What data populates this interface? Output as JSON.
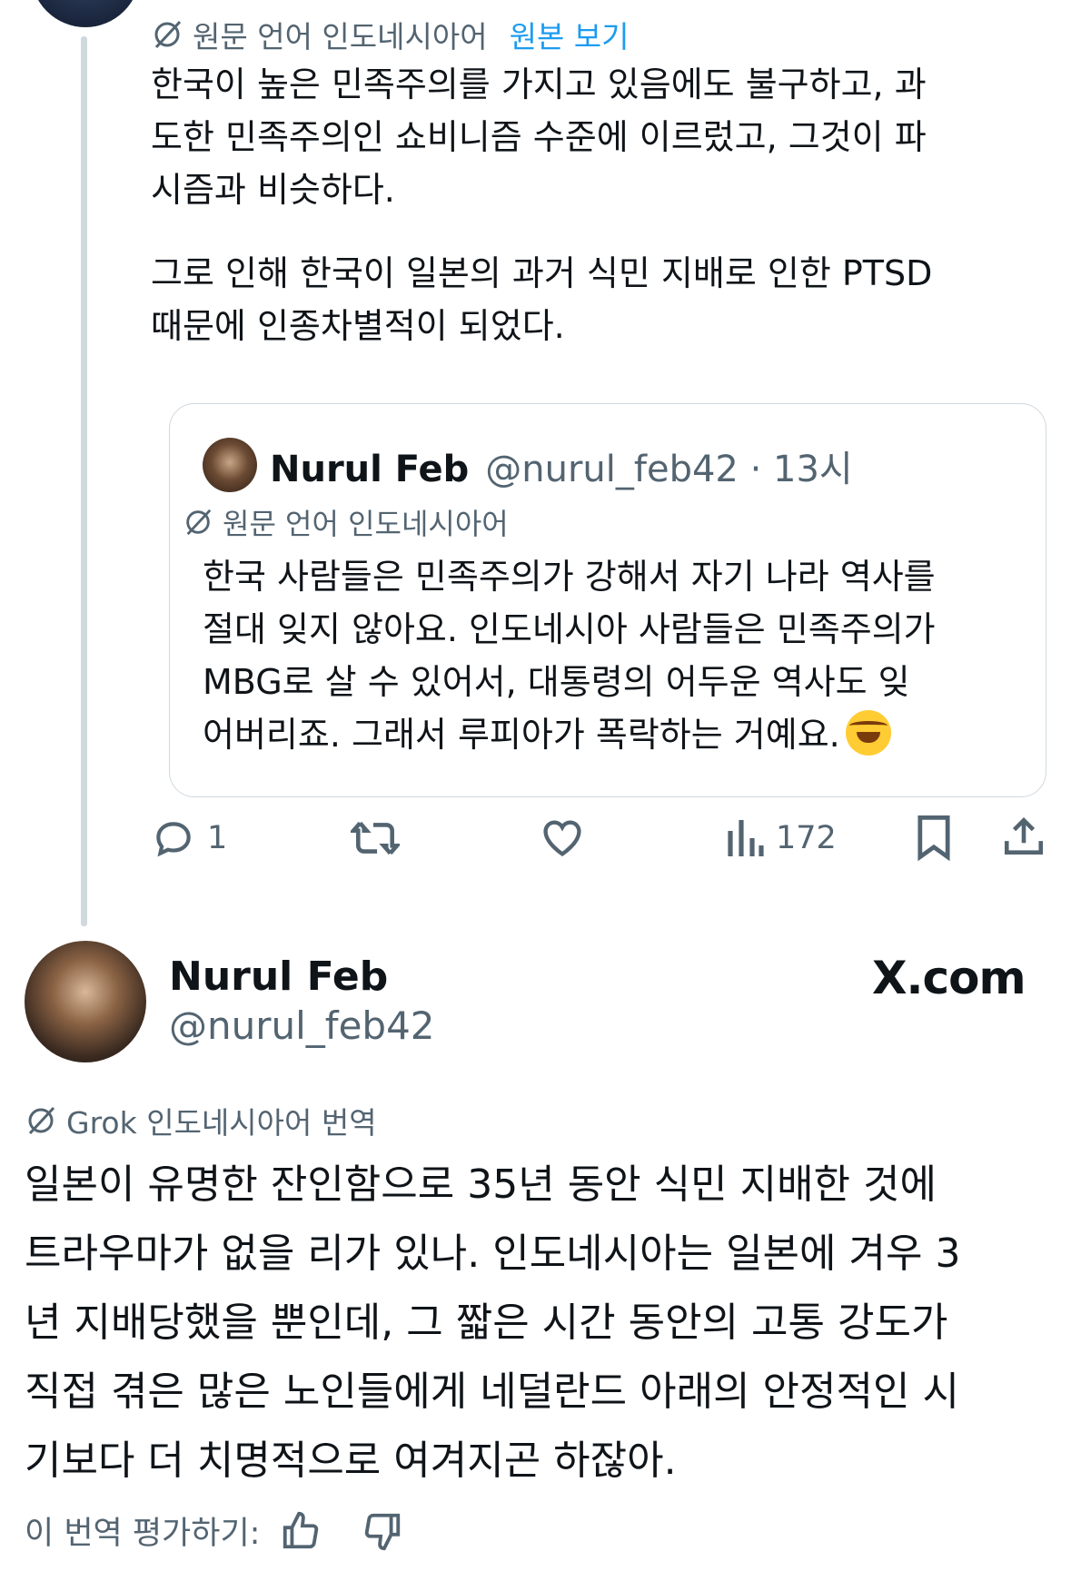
{
  "top_post": {
    "translation_label": "원문 언어 인도네시아어",
    "show_original": "원본 보기",
    "paragraph1": "한국이 높은 민족주의를 가지고 있음에도 불구하고, 과\n도한 민족주의인 쇼비니즘 수준에 이르렀고, 그것이 파\n시즘과 비슷하다.",
    "paragraph2": "그로 인해 한국이 일본의 과거 식민 지배로 인한 PTSD\n때문에 인종차별적이 되었다."
  },
  "quote": {
    "name": "Nurul Feb",
    "handle_time": "@nurul_feb42 · 13시",
    "translation_label": "원문 언어 인도네시아어",
    "text": "한국 사람들은 민족주의가 강해서 자기 나라 역사를\n절대 잊지 않아요. 인도네시아 사람들은 민족주의가\nMBG로 살 수 있어서, 대통령의 어두운 역사도 잊\n어버리죠. 그래서 루피아가 폭락하는 거예요.",
    "emoji": "rolling-on-floor-laughing"
  },
  "actions": {
    "reply_count": "1",
    "views_count": "172"
  },
  "post": {
    "name": "Nurul Feb",
    "handle": "@nurul_feb42",
    "brand": "X.com",
    "translation_label": "Grok 인도네시아어 번역",
    "text": "일본이 유명한 잔인함으로 35년 동안 식민 지배한 것에\n트라우마가 없을 리가 있나. 인도네시아는 일본에 겨우 3\n년 지배당했을 뿐인데, 그 짧은 시간 동안의 고통 강도가\n직접 겪은 많은 노인들에게 네덜란드 아래의 안정적인 시\n기보다 더 치명적으로 여겨지곤 하잖아.",
    "rate_label": "이 번역 평가하기:"
  },
  "colors": {
    "link": "#1d9bf0",
    "muted": "#536471",
    "text": "#0f1419",
    "border": "#cfd9de"
  }
}
